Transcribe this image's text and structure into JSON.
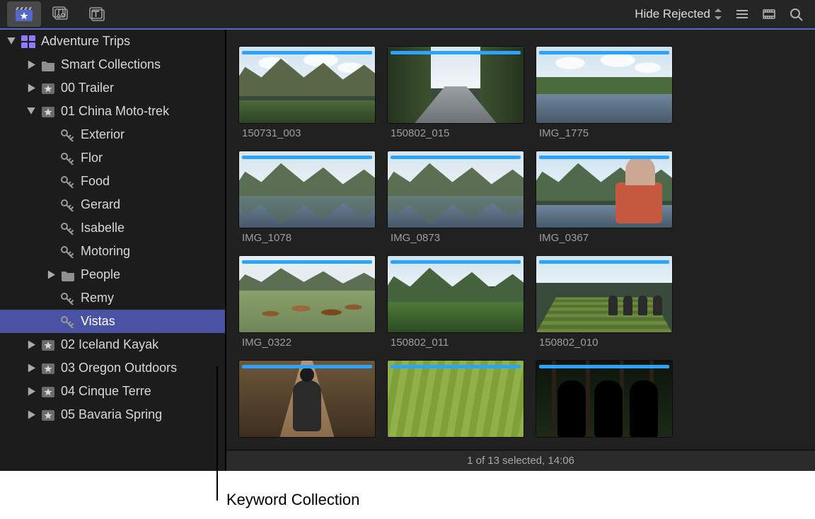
{
  "toolbar": {
    "filter_label": "Hide Rejected"
  },
  "sidebar": {
    "rows": [
      {
        "label": "Adventure Trips",
        "icon": "library",
        "indent": 0,
        "disclosure": "open"
      },
      {
        "label": "Smart Collections",
        "icon": "folder",
        "indent": 1,
        "disclosure": "closed"
      },
      {
        "label": "00 Trailer",
        "icon": "event",
        "indent": 1,
        "disclosure": "closed"
      },
      {
        "label": "01 China Moto-trek",
        "icon": "event",
        "indent": 1,
        "disclosure": "open"
      },
      {
        "label": "Exterior",
        "icon": "keyword",
        "indent": 2,
        "disclosure": "none"
      },
      {
        "label": "Flor",
        "icon": "keyword",
        "indent": 2,
        "disclosure": "none"
      },
      {
        "label": "Food",
        "icon": "keyword",
        "indent": 2,
        "disclosure": "none"
      },
      {
        "label": "Gerard",
        "icon": "keyword",
        "indent": 2,
        "disclosure": "none"
      },
      {
        "label": "Isabelle",
        "icon": "keyword",
        "indent": 2,
        "disclosure": "none"
      },
      {
        "label": "Motoring",
        "icon": "keyword",
        "indent": 2,
        "disclosure": "none"
      },
      {
        "label": "People",
        "icon": "folder",
        "indent": 2,
        "disclosure": "closed"
      },
      {
        "label": "Remy",
        "icon": "keyword",
        "indent": 2,
        "disclosure": "none"
      },
      {
        "label": "Vistas",
        "icon": "keyword",
        "indent": 2,
        "disclosure": "none",
        "selected": true
      },
      {
        "label": "02 Iceland Kayak",
        "icon": "event",
        "indent": 1,
        "disclosure": "closed"
      },
      {
        "label": "03 Oregon Outdoors",
        "icon": "event",
        "indent": 1,
        "disclosure": "closed"
      },
      {
        "label": "04 Cinque Terre",
        "icon": "event",
        "indent": 1,
        "disclosure": "closed"
      },
      {
        "label": "05 Bavaria Spring",
        "icon": "event",
        "indent": 1,
        "disclosure": "closed"
      }
    ]
  },
  "clips": [
    {
      "label": "150731_003",
      "scene": "great-wall"
    },
    {
      "label": "150802_015",
      "scene": "moto-road"
    },
    {
      "label": "IMG_1775",
      "scene": "lake"
    },
    {
      "label": "IMG_1078",
      "scene": "karst-reflect"
    },
    {
      "label": "IMG_0873",
      "scene": "karst-reflect2"
    },
    {
      "label": "IMG_0367",
      "scene": "man-river"
    },
    {
      "label": "IMG_0322",
      "scene": "river-boats"
    },
    {
      "label": "150802_011",
      "scene": "green-valley"
    },
    {
      "label": "150802_010",
      "scene": "terraces-people"
    },
    {
      "label": "",
      "scene": "hiker-back"
    },
    {
      "label": "",
      "scene": "rice-field"
    },
    {
      "label": "",
      "scene": "forest-silh"
    }
  ],
  "status": "1 of 13 selected, 14:06",
  "callout": "Keyword Collection"
}
